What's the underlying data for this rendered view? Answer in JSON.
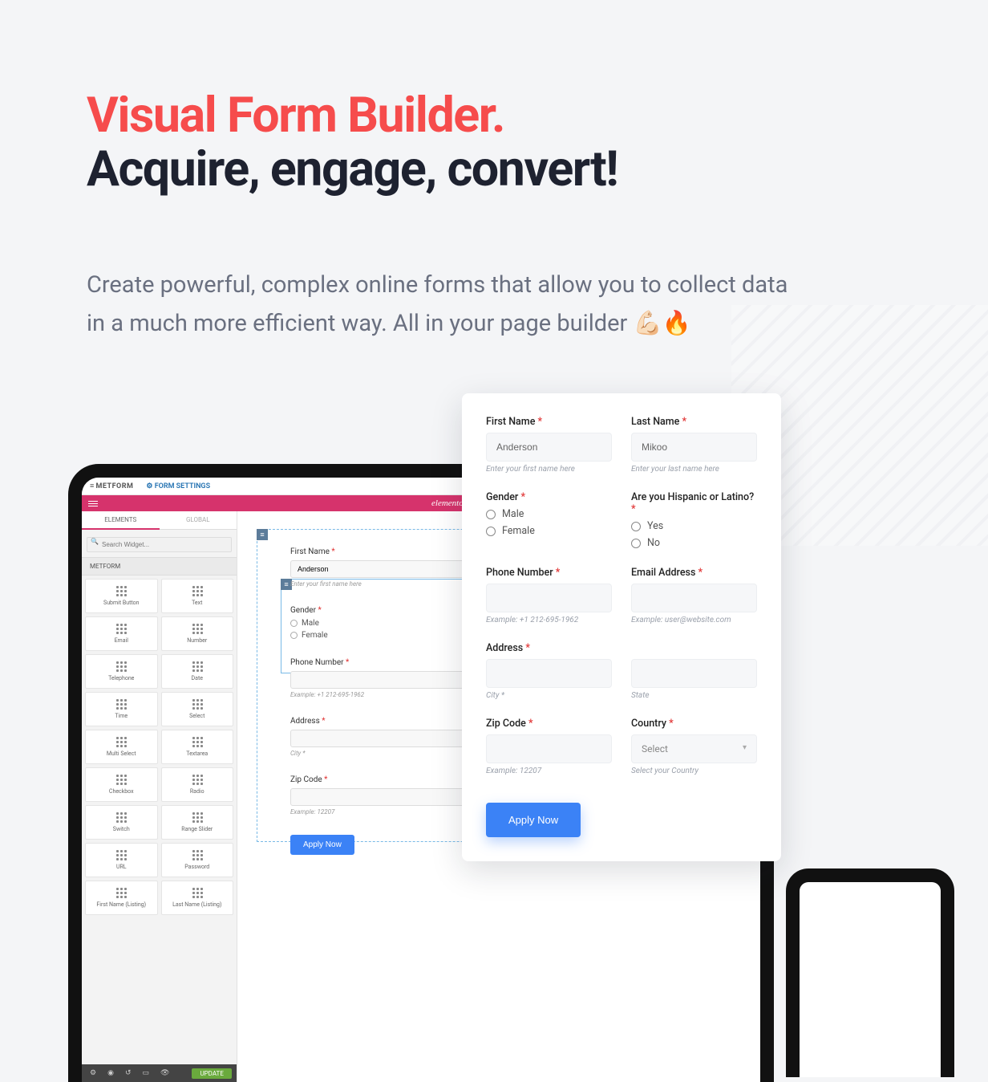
{
  "hero": {
    "title_accent": "Visual Form Builder",
    "title_rest": "Acquire, engage, convert!",
    "subtitle": "Create powerful, complex online forms that allow you to collect data in a much more efficient way. All in your page builder 💪🏻🔥"
  },
  "editor": {
    "brand": "METFORM",
    "settings": "FORM SETTINGS",
    "logo": "elementor",
    "tabs": {
      "elements": "ELEMENTS",
      "global": "GLOBAL"
    },
    "search_placeholder": "Search Widget...",
    "category": "METFORM",
    "widgets": [
      "Submit Button",
      "Text",
      "Email",
      "Number",
      "Telephone",
      "Date",
      "Time",
      "Select",
      "Multi Select",
      "Textarea",
      "Checkbox",
      "Radio",
      "Switch",
      "Range Slider",
      "URL",
      "Password",
      "First Name (Listing)",
      "Last Name (Listing)"
    ],
    "update": "UPDATE"
  },
  "mini_form": {
    "first_name": {
      "label": "First Name",
      "value": "Anderson",
      "hint": "Enter your first name here"
    },
    "gender": {
      "label": "Gender",
      "options": [
        "Male",
        "Female"
      ]
    },
    "phone": {
      "label": "Phone Number",
      "hint": "Example: +1 212-695-1962"
    },
    "address": {
      "label": "Address",
      "hint": "City *"
    },
    "zip": {
      "label": "Zip Code",
      "hint": "Example: 12207"
    },
    "apply": "Apply Now"
  },
  "form": {
    "first_name": {
      "label": "First Name",
      "value": "Anderson",
      "hint": "Enter your first name here"
    },
    "last_name": {
      "label": "Last Name",
      "value": "Mikoo",
      "hint": "Enter your last name here"
    },
    "gender": {
      "label": "Gender",
      "options": [
        "Male",
        "Female"
      ]
    },
    "hispanic": {
      "label": "Are you Hispanic or Latino?",
      "options": [
        "Yes",
        "No"
      ]
    },
    "phone": {
      "label": "Phone Number",
      "hint": "Example: +1 212-695-1962"
    },
    "email": {
      "label": "Email Address",
      "hint": "Example: user@website.com"
    },
    "address": {
      "label": "Address",
      "hint_city": "City *",
      "hint_state": "State"
    },
    "zip": {
      "label": "Zip Code",
      "hint": "Example: 12207"
    },
    "country": {
      "label": "Country",
      "placeholder": "Select",
      "hint": "Select your Country"
    },
    "apply": "Apply Now"
  }
}
